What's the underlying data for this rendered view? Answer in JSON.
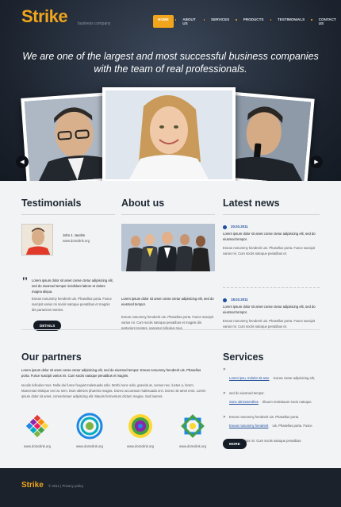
{
  "brand": {
    "logo": "Strike",
    "tagline": "business company",
    "accent": "#f0a51c"
  },
  "nav": [
    {
      "label": "Home",
      "active": true
    },
    {
      "label": "About Us",
      "active": false
    },
    {
      "label": "Services",
      "active": false
    },
    {
      "label": "Products",
      "active": false
    },
    {
      "label": "Testimonials",
      "active": false
    },
    {
      "label": "Contact Us",
      "active": false
    }
  ],
  "hero": {
    "text": "We are one of the largest and most successful business companies with the team of real professionals.",
    "prev_icon": "chevron-left-icon",
    "next_icon": "chevron-right-icon"
  },
  "testimonials": {
    "title": "Testimonials",
    "person_name": "John J. Jacobs",
    "person_link": "www.domolink.org",
    "quote": "Lorem ipsum dolor sit amet conse ctetur adipisicing elit, sed do eiusmod tempor incididunt labore et dolore magna aliqua.",
    "body": "Enean nonummy hendrerit uis. Phasellus porta. Fusce suscipit varius mi sociis natoque penatibus et magnis dis parturient montes.",
    "button": "Details"
  },
  "about": {
    "title": "About us",
    "p1": "Lorem ipsum dolor sit amet conse ctetur adipisicing elit, sed do eiusmod tempor.",
    "p2": "Enean nonummy hendrerit uis. Phasellus porta. Fusce suscipit varius mi. Cum sociis natoque penatibus et magnis dis parturient montes, nascetur ridiculus mus."
  },
  "news": {
    "title": "Latest news",
    "items": [
      {
        "date": "20.03.2011",
        "lead": "Lorem ipsum dolor sit amet conse ctetur adipisicing elit, sed do eiusmod tempor.",
        "body": "Enean nonummy hendrerit uis. Phasellus porta. Fusce suscipit varius mi. Cum sociis natoque penatibus et."
      },
      {
        "date": "18.03.2011",
        "lead": "Lorem ipsum dolor sit amet conse ctetur adipisicing elit, sed do eiusmod tempor.",
        "body": "Enean nonummy hendrerit uis. Phasellus porta. Fusce suscipit varius mi. Cum sociis natoque penatibus et."
      }
    ]
  },
  "partners": {
    "title": "Our partners",
    "lead": "Lorem ipsum dolor sit amet conse ctetur adipisicing elit, sed do eiusmod tempor. Enean nonummy hendrerit uis. Phasellus porta. Fusce suscipit varius mi. Cum sociis natoque penatibus et magnis.",
    "body": "Iaculis ridiculus mus. Nulla dui fusce feugiat malesuada odio. Morbi nunc odio, gravida at, cursus nec, luctus a, lorem. Maecenas tristique orci ac sem. Duis ultricies pharetra magna. Donec accumsan malesuada orci. Donec sit amet eros. Lorem ipsum dolor sit amet, consectetuer adipiscing elit. Mauris fermentum dictum magna. Sed laoreet.",
    "logos": [
      {
        "url": "www.domolink.org",
        "colors": [
          "#e53935",
          "#8e24aa",
          "#1e88e5",
          "#43a047",
          "#fdd835"
        ]
      },
      {
        "url": "www.domolink.org",
        "colors": [
          "#1e88e5",
          "#00acc1",
          "#7cb342"
        ]
      },
      {
        "url": "www.domolink.org",
        "colors": [
          "#fdd835",
          "#43a047",
          "#8e24aa",
          "#1e88e5"
        ]
      },
      {
        "url": "www.domolink.org",
        "colors": [
          "#1e88e5",
          "#43a047",
          "#fdd835"
        ]
      }
    ]
  },
  "services": {
    "title": "Services",
    "items": [
      {
        "link": "Lorem ipsu, mdolor sit ame",
        "rest": "tconse ctetur adipisicing elit, sed do eiusmod tempor."
      },
      {
        "link": "Sone ultricesenthee",
        "rest": "tibuum molestaum socio natoque. Enean nonummy hendrerit uis. Phasellus porta."
      },
      {
        "link": "Enean nonummy hendrerit",
        "rest": "uis. Phasellus porta. Fusce suscipit varius mi. Cum sociis natoque penatibus."
      }
    ],
    "button": "More"
  },
  "footer": {
    "logo": "Strike",
    "text": "© 2011 | Privacy policy"
  }
}
